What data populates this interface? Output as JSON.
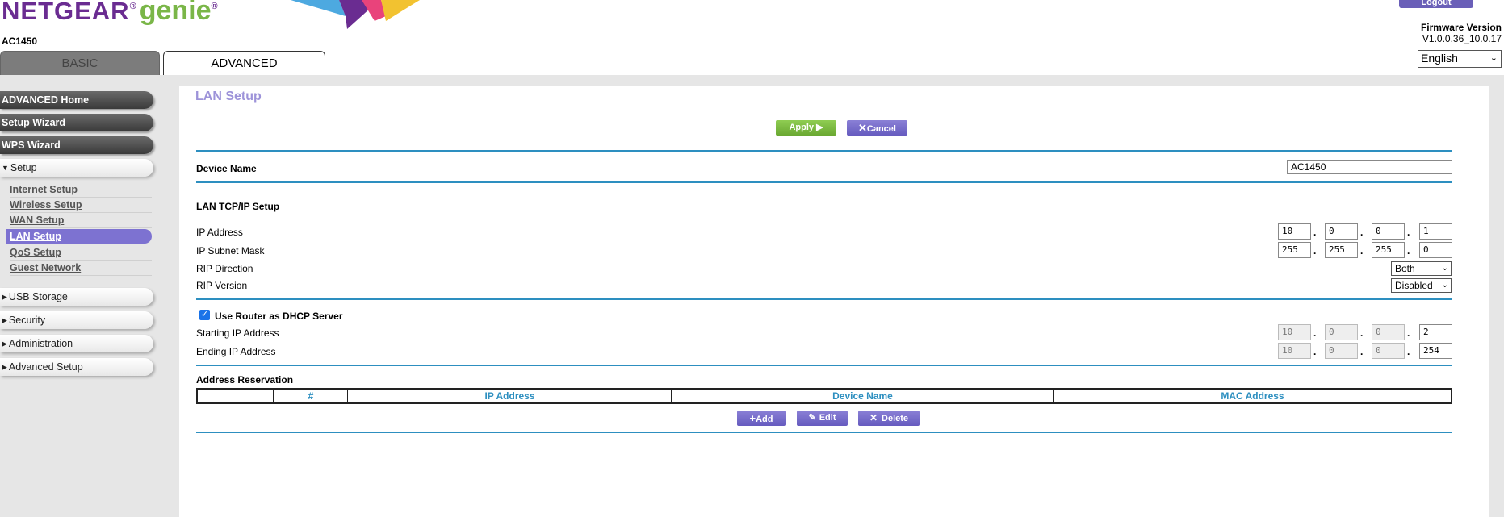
{
  "header": {
    "brand_main": "NETGEAR",
    "brand_reg": "®",
    "brand_genie": "genie",
    "brand_genie_reg": "®",
    "model": "AC1450",
    "logout_label": "Logout",
    "firmware_label": "Firmware Version",
    "firmware_value": "V1.0.0.36_10.0.17",
    "language": "English"
  },
  "tabs": {
    "basic": "BASIC",
    "advanced": "ADVANCED"
  },
  "sidebar": {
    "advanced_home": "ADVANCED Home",
    "setup_wizard": "Setup Wizard",
    "wps_wizard": "WPS Wizard",
    "setup": "Setup",
    "setup_items": [
      "Internet Setup",
      "Wireless Setup",
      "WAN Setup",
      "LAN Setup",
      "QoS Setup",
      "Guest Network"
    ],
    "usb_storage": "USB Storage",
    "security": "Security",
    "administration": "Administration",
    "advanced_setup": "Advanced Setup"
  },
  "page": {
    "title": "LAN Setup",
    "apply_label": "Apply ▶",
    "cancel_label": "Cancel",
    "device_name_label": "Device Name",
    "device_name_value": "AC1450",
    "tcpip_heading": "LAN TCP/IP Setup",
    "ip_address_label": "IP Address",
    "ip_address": [
      "10",
      "0",
      "0",
      "1"
    ],
    "subnet_label": "IP Subnet Mask",
    "subnet": [
      "255",
      "255",
      "255",
      "0"
    ],
    "rip_direction_label": "RIP Direction",
    "rip_direction_value": "Both",
    "rip_version_label": "RIP Version",
    "rip_version_value": "Disabled",
    "dhcp_label": "Use Router as DHCP Server",
    "dhcp_checked": true,
    "start_ip_label": "Starting IP Address",
    "start_ip": [
      "10",
      "0",
      "0",
      "2"
    ],
    "end_ip_label": "Ending IP Address",
    "end_ip": [
      "10",
      "0",
      "0",
      "254"
    ],
    "reservation_heading": "Address Reservation",
    "table_headers": [
      "",
      "#",
      "IP Address",
      "Device Name",
      "MAC Address"
    ],
    "add_label": "Add",
    "edit_label": "Edit",
    "delete_label": "Delete"
  },
  "colors": {
    "brand_purple": "#6a2c91",
    "genie_green": "#7ab648",
    "accent_blue": "#2d8fc0",
    "button_purple": "#6a5fb8",
    "button_green": "#7ab648",
    "active_nav": "#7d72d1"
  }
}
